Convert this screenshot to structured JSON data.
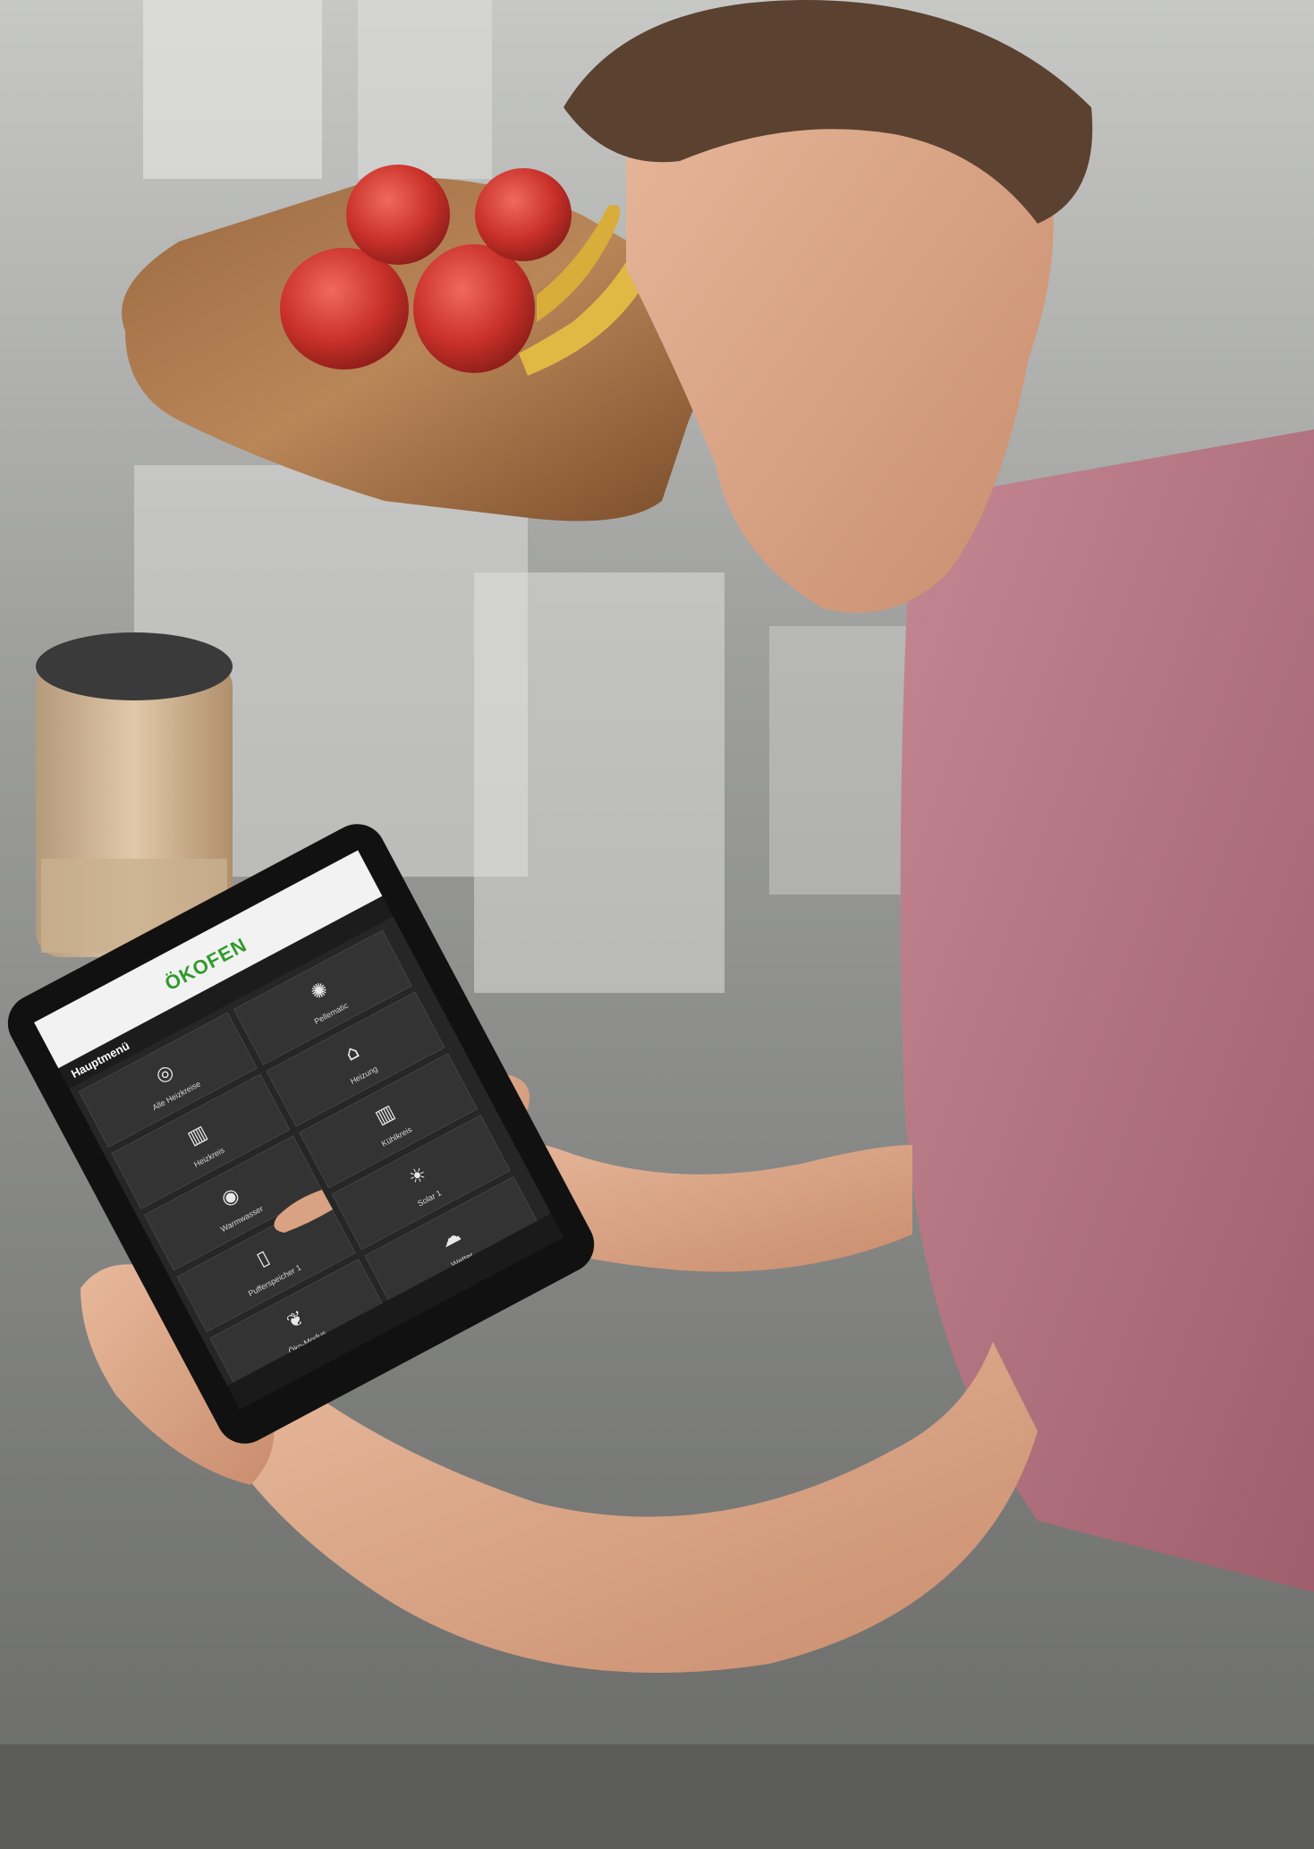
{
  "app": {
    "brand": "ÖKOFEN",
    "page_title": "Hauptmenü",
    "brand_color": "#2f9a2a"
  },
  "tiles": [
    {
      "label": "Alle Heizkreise",
      "icon": "radiator-group-icon"
    },
    {
      "label": "Pellematic",
      "icon": "sun-icon"
    },
    {
      "label": "Heizkreis",
      "icon": "radiator-icon"
    },
    {
      "label": "Heizung",
      "icon": "house-icon"
    },
    {
      "label": "Warmwasser",
      "icon": "water-tank-icon"
    },
    {
      "label": "Kühlkreis",
      "icon": "radiator-icon"
    },
    {
      "label": "Pufferspeicher 1",
      "icon": "buffer-tank-icon"
    },
    {
      "label": "Solar 1",
      "icon": "solar-icon"
    },
    {
      "label": "Öko-Modus",
      "icon": "eco-leaf-icon"
    },
    {
      "label": "Wetter",
      "icon": "weather-icon"
    }
  ]
}
